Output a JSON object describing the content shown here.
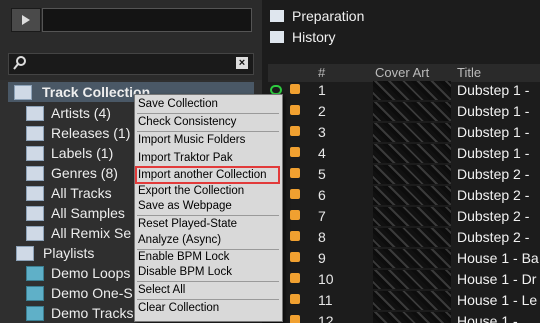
{
  "tree": {
    "root": "Track Collection",
    "items": [
      "Artists (4)",
      "Releases (1)",
      "Labels (1)",
      "Genres (8)",
      "All Tracks",
      "All Samples",
      "All Remix Se"
    ],
    "playlists_label": "Playlists",
    "playlists": [
      "Demo Loops",
      "Demo One-S",
      "Demo Tracks"
    ]
  },
  "top_items": [
    "Preparation",
    "History"
  ],
  "table": {
    "headers": [
      "#",
      "Cover Art",
      "Title"
    ],
    "rows": [
      {
        "num": "1",
        "title": "Dubstep 1 -"
      },
      {
        "num": "2",
        "title": "Dubstep 1 -"
      },
      {
        "num": "3",
        "title": "Dubstep 1 -"
      },
      {
        "num": "4",
        "title": "Dubstep 1 -"
      },
      {
        "num": "5",
        "title": "Dubstep 2 -"
      },
      {
        "num": "6",
        "title": "Dubstep 2 -"
      },
      {
        "num": "7",
        "title": "Dubstep 2 -"
      },
      {
        "num": "8",
        "title": "Dubstep 2 -"
      },
      {
        "num": "9",
        "title": "House 1 - Ba"
      },
      {
        "num": "10",
        "title": "House 1 - Dr"
      },
      {
        "num": "11",
        "title": "House 1 - Le"
      },
      {
        "num": "12",
        "title": "House 1 - ..."
      }
    ]
  },
  "menu": [
    "Save Collection",
    "Check Consistency",
    "Import Music Folders",
    "Import Traktor Pak",
    "Import another Collection",
    "Export the Collection",
    "Save as Webpage",
    "Reset Played-State",
    "Analyze (Async)",
    "Enable BPM Lock",
    "Disable BPM Lock",
    "Select All",
    "Clear Collection"
  ]
}
